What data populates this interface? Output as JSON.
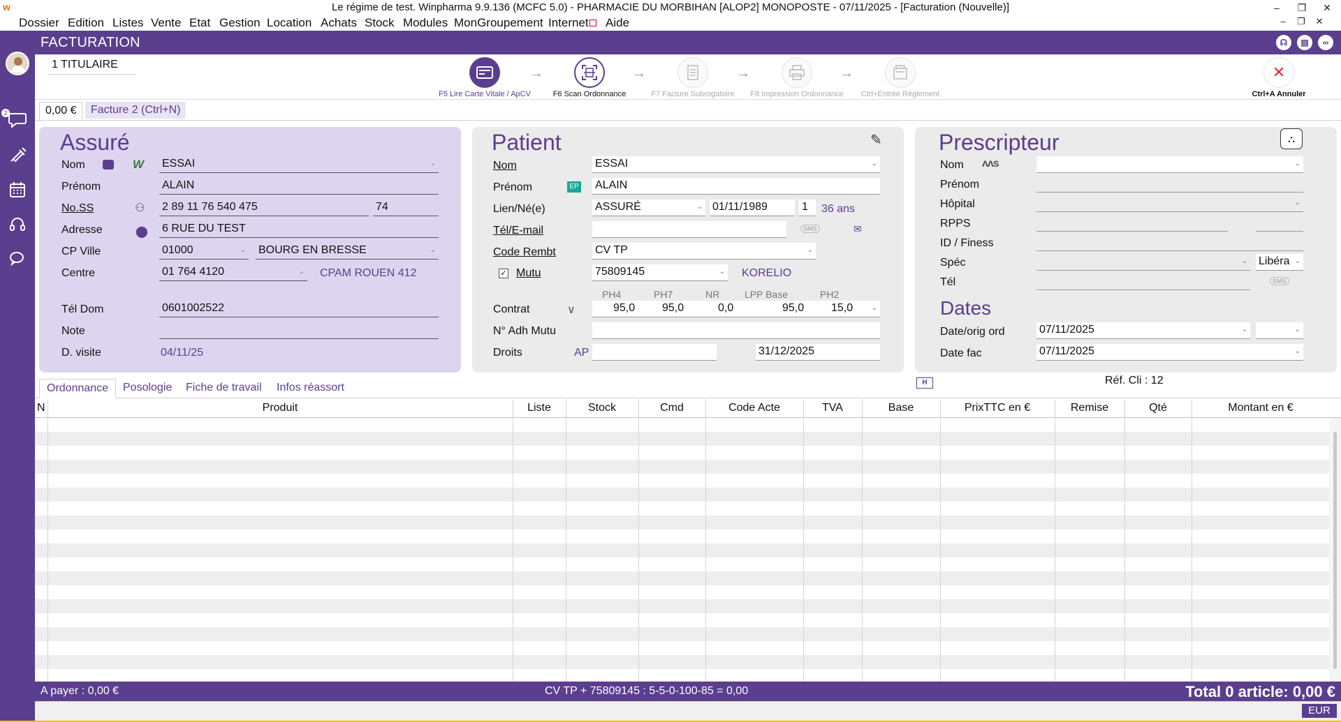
{
  "window": {
    "title": "Le régime de test. Winpharma 9.9.136  (MCFC 5.0) - PHARMACIE DU MORBIHAN [ALOP2] MONOPOSTE - 07/11/2025 - [Facturation (Nouvelle)]",
    "minimize": "–",
    "restore": "❐",
    "close": "✕"
  },
  "menu": [
    "Dossier",
    "Edition",
    "Listes",
    "Vente",
    "Etat",
    "Gestion",
    "Location",
    "Achats",
    "Stock",
    "Modules",
    "MonGroupement",
    "Internet",
    "Aide"
  ],
  "header": {
    "title": "FACTURATION"
  },
  "toolbar": {
    "titulaire": "1 TITULAIRE",
    "steps": [
      {
        "label": "F5 Lire Carte Vitale / ApCV"
      },
      {
        "label": "F6 Scan Ordonnance"
      },
      {
        "label": "F7 Facture Subrogatoire"
      },
      {
        "label": "F8 Impression Ordonnance"
      },
      {
        "label": "Ctrl+Entrée Règlement"
      }
    ],
    "cancel": "Ctrl+A Annuler"
  },
  "doc_tabs": [
    "0,00 €",
    "Facture 2 (Ctrl+N)"
  ],
  "assure": {
    "title": "Assuré",
    "labels": {
      "nom": "Nom",
      "prenom": "Prénom",
      "noss": "No.SS",
      "adresse": "Adresse",
      "cpville": "CP Ville",
      "centre": "Centre",
      "teldom": "Tél Dom",
      "note": "Note",
      "dvisite": "D. visite"
    },
    "nom": "ESSAI",
    "prenom": "ALAIN",
    "noss": "2 89 11 76 540 475",
    "noss_key": "74",
    "adresse": "6 RUE DU TEST",
    "cp": "01000",
    "ville": "BOURG EN BRESSE",
    "centre": "01 764 4120",
    "centre_name": "CPAM ROUEN 412",
    "teldom": "0601002522",
    "note": "",
    "dvisite": "04/11/25"
  },
  "patient": {
    "title": "Patient",
    "labels": {
      "nom": "Nom",
      "prenom": "Prénom",
      "lien": "Lien/Né(e)",
      "telmail": "Tél/E-mail",
      "coderembt": "Code Rembt",
      "mutu": "Mutu",
      "contrat": "Contrat",
      "adh": "N° Adh Mutu",
      "droits": "Droits"
    },
    "ep_badge": "EP",
    "nom": "ESSAI",
    "prenom": "ALAIN",
    "lien": "ASSURÉ",
    "naissance": "01/11/1989",
    "rang": "1",
    "age": "36 ans",
    "sms_badge": "SMS",
    "telmail": "",
    "coderembt": "CV TP",
    "mutu_checked": true,
    "mutu": "75809145",
    "mutu_name": "KORELIO",
    "contrat_headers": [
      "PH4",
      "PH7",
      "NR",
      "LPP Base",
      "PH2"
    ],
    "contrat_values": [
      "95,0",
      "95,0",
      "0,0",
      "95,0",
      "15,0"
    ],
    "adh": "",
    "droits_prefix": "AP",
    "droits_start": "",
    "droits_end": "31/12/2025"
  },
  "prescripteur": {
    "title": "Prescripteur",
    "labels": {
      "nom": "Nom",
      "prenom": "Prénom",
      "hopital": "Hôpital",
      "rpps": "RPPS",
      "idfiness": "ID / Finess",
      "spec": "Spéc",
      "tel": "Tél"
    },
    "spec_type": "Libéra",
    "sms_badge": "SMS"
  },
  "dates": {
    "title": "Dates",
    "labels": {
      "dateorig": "Date/orig ord",
      "datefac": "Date fac"
    },
    "dateorig": "07/11/2025",
    "datefac": "07/11/2025",
    "h_badge": "H",
    "refcli": "Réf. Cli : 12"
  },
  "ord_tabs": [
    "Ordonnance",
    "Posologie",
    "Fiche de travail",
    "Infos réassort"
  ],
  "grid": {
    "columns": [
      "N",
      "Produit",
      "Liste",
      "Stock",
      "Cmd",
      "Code Acte",
      "TVA",
      "Base",
      "PrixTTC en €",
      "Remise",
      "Qté",
      "Montant en €"
    ]
  },
  "footer": {
    "apayer": "A payer :  0,00 €",
    "formula": "CV TP + 75809145 : 5-5-0-100-85 = 0,00",
    "total": "Total 0 article:  0,00 €"
  },
  "status": {
    "currency": "EUR"
  },
  "colors": {
    "accent": "#5b3e8e",
    "panel_assure": "#ddd5f0",
    "panel_grey": "#ebebeb"
  }
}
